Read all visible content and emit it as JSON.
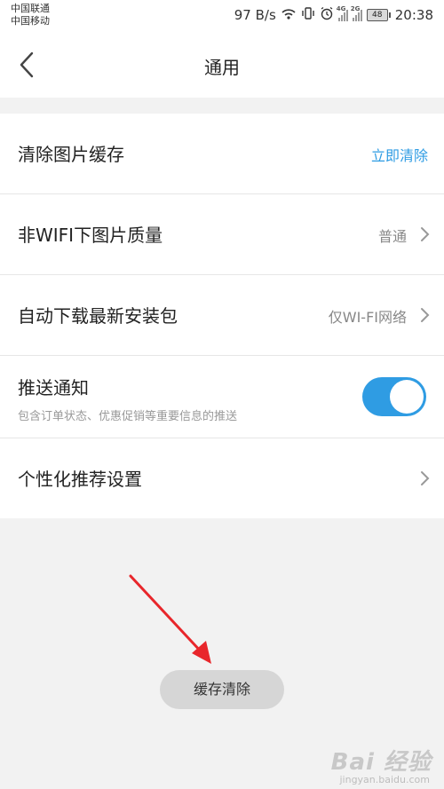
{
  "status_bar": {
    "carrier_1": "中国联通",
    "carrier_2": "中国移动",
    "net_speed": "97 B/s",
    "signal_1_tag": "4G",
    "signal_2_tag": "2G",
    "battery": "48",
    "time": "20:38",
    "icons": [
      "wifi-icon",
      "vibrate-icon",
      "alarm-icon"
    ]
  },
  "header": {
    "title": "通用",
    "back_icon": "chevron-left-icon"
  },
  "settings": {
    "clear_cache": {
      "label": "清除图片缓存",
      "action": "立即清除"
    },
    "image_quality": {
      "label": "非WIFI下图片质量",
      "value": "普通"
    },
    "auto_download": {
      "label": "自动下载最新安装包",
      "value": "仅WI-FI网络"
    },
    "push": {
      "label": "推送通知",
      "subtitle": "包含订单状态、优惠促销等重要信息的推送",
      "enabled": true
    },
    "personalization": {
      "label": "个性化推荐设置"
    }
  },
  "cache_button": {
    "label": "缓存清除"
  },
  "watermark": {
    "text": "Bai 经验",
    "sub": "jingyan.baidu.com"
  },
  "colors": {
    "accent": "#2f9ce3",
    "arrow": "#e8262b"
  }
}
